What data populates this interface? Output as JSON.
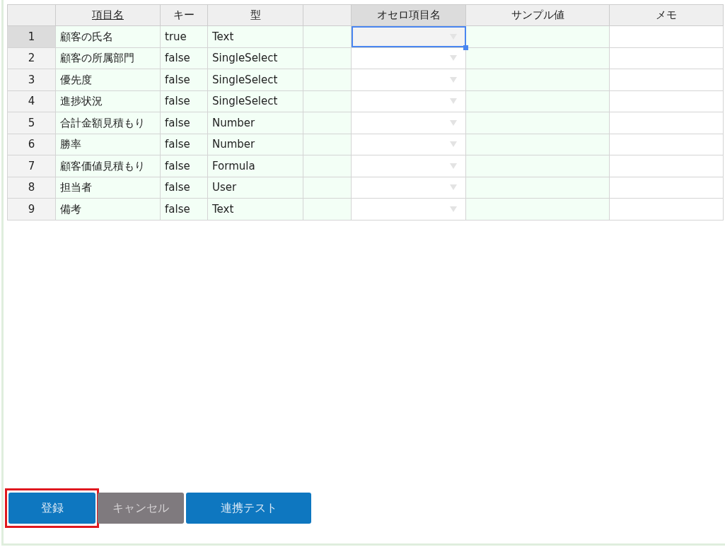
{
  "table": {
    "columns": [
      {
        "kind": "rownum",
        "selected": false,
        "underlined": false
      },
      {
        "kind": "text",
        "label": "項目名",
        "selected": false,
        "underlined": true
      },
      {
        "kind": "text",
        "label": "キー",
        "selected": false,
        "underlined": false
      },
      {
        "kind": "text",
        "label": "型",
        "selected": false,
        "underlined": false
      },
      {
        "kind": "text",
        "selected": false,
        "underlined": false
      },
      {
        "kind": "dropdown",
        "label": "オセロ項目名",
        "selected": true,
        "underlined": false
      },
      {
        "kind": "input",
        "label": "サンプル値",
        "selected": false,
        "underlined": false
      },
      {
        "kind": "memo",
        "label": "メモ",
        "selected": false,
        "underlined": false
      }
    ],
    "rows": [
      {
        "number": "1",
        "name": "顧客の氏名",
        "key": "true",
        "type": "Text",
        "selected": true
      },
      {
        "number": "2",
        "name": "顧客の所属部門",
        "key": "false",
        "type": "SingleSelect",
        "selected": false
      },
      {
        "number": "3",
        "name": "優先度",
        "key": "false",
        "type": "SingleSelect",
        "selected": false
      },
      {
        "number": "4",
        "name": "進捗状況",
        "key": "false",
        "type": "SingleSelect",
        "selected": false
      },
      {
        "number": "5",
        "name": "合計金額見積もり",
        "key": "false",
        "type": "Number",
        "selected": false
      },
      {
        "number": "6",
        "name": "勝率",
        "key": "false",
        "type": "Number",
        "selected": false
      },
      {
        "number": "7",
        "name": "顧客価値見積もり",
        "key": "false",
        "type": "Formula",
        "selected": false
      },
      {
        "number": "8",
        "name": "担当者",
        "key": "false",
        "type": "User",
        "selected": false
      },
      {
        "number": "9",
        "name": "備考",
        "key": "false",
        "type": "Text",
        "selected": false
      }
    ]
  },
  "buttons": [
    {
      "label": "登録",
      "kind": "primary",
      "highlighted": true
    },
    {
      "label": "キャンセル",
      "kind": "secondary",
      "highlighted": false
    },
    {
      "label": "連携テスト",
      "kind": "primary",
      "highlighted": false
    }
  ]
}
